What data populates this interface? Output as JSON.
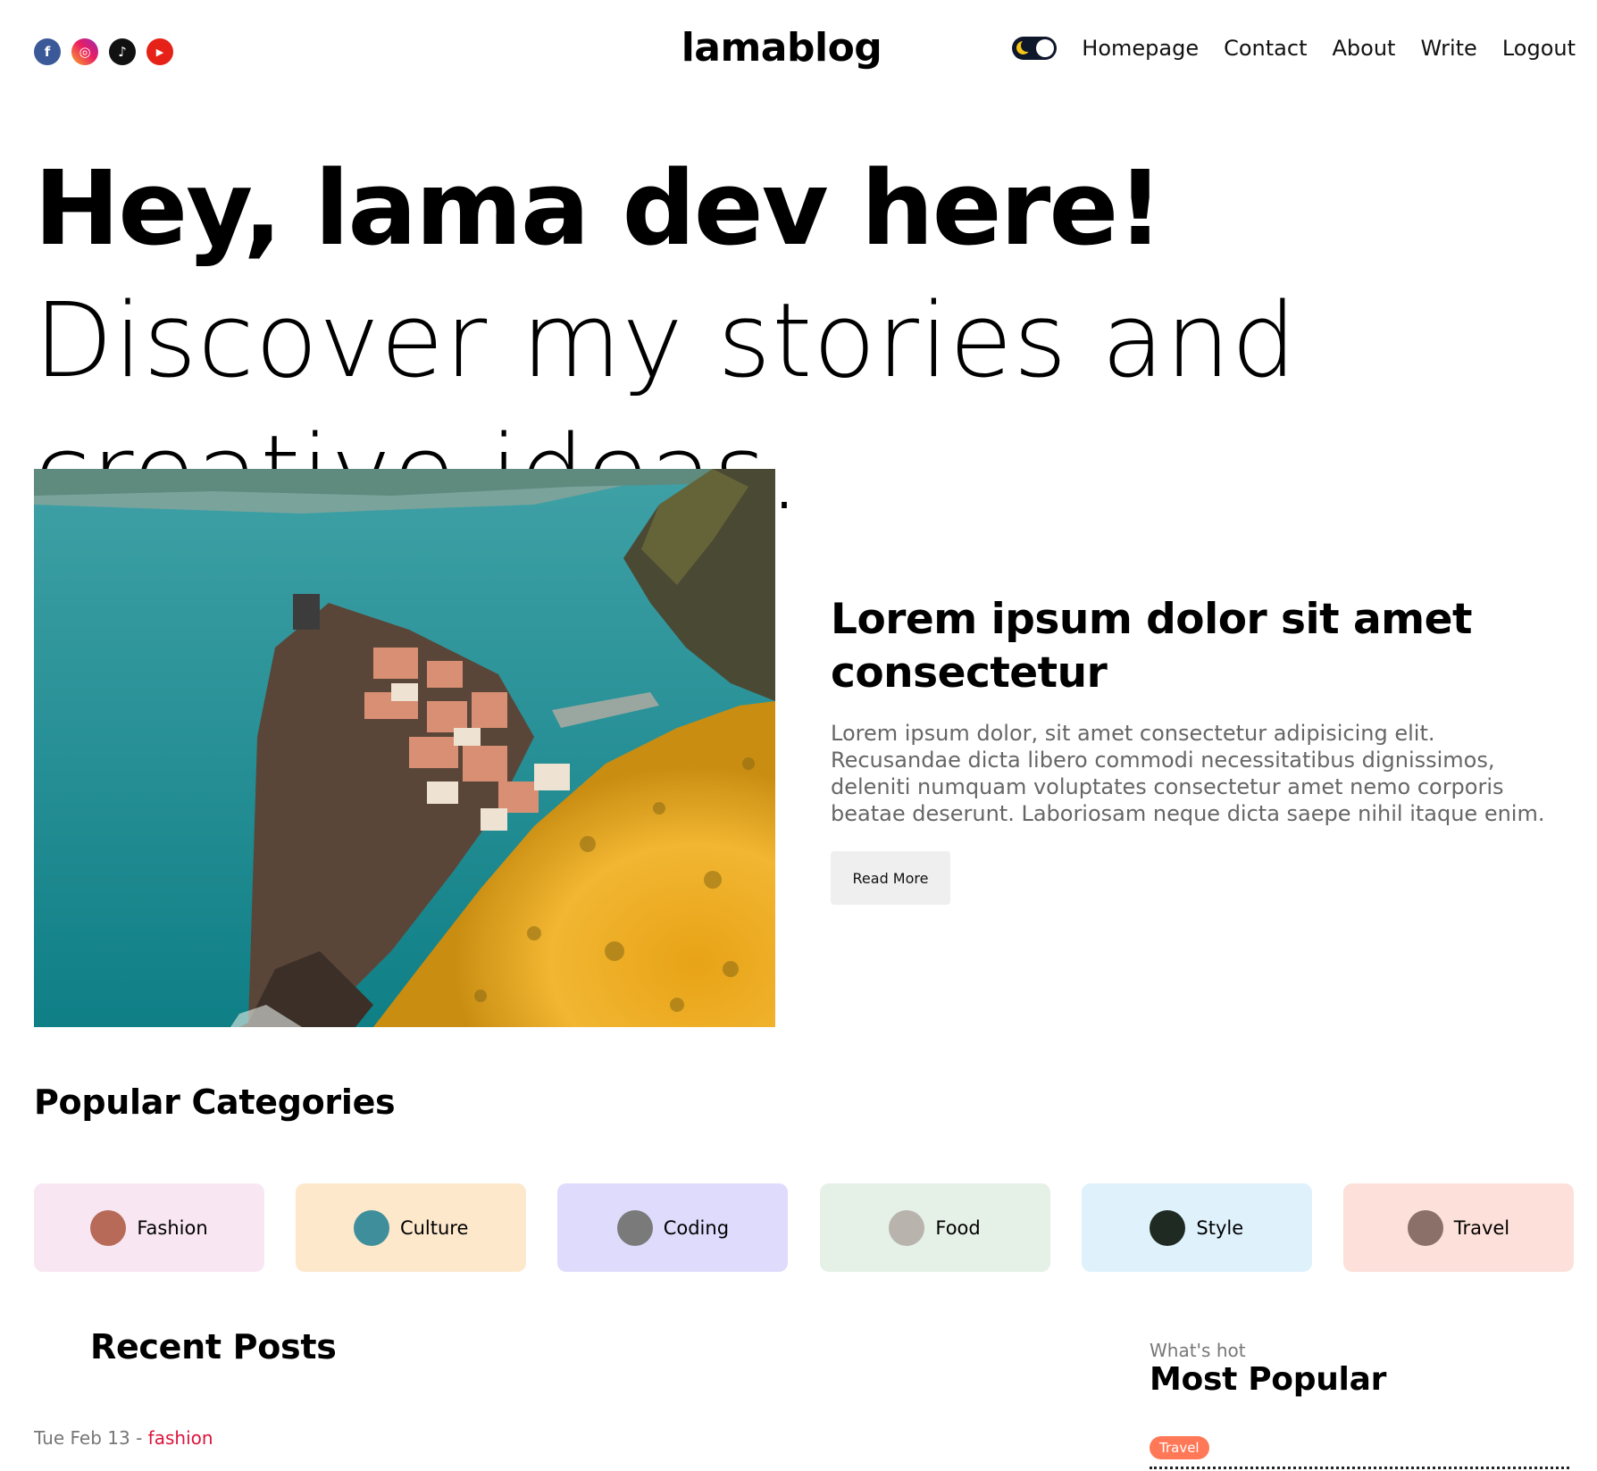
{
  "navbar": {
    "socials": [
      {
        "icon": "facebook-icon",
        "glyph": "f"
      },
      {
        "icon": "instagram-icon",
        "glyph": "◎"
      },
      {
        "icon": "tiktok-icon",
        "glyph": "♪"
      },
      {
        "icon": "youtube-icon",
        "glyph": "▶"
      }
    ],
    "logo": "lamablog",
    "links": [
      "Homepage",
      "Contact",
      "About",
      "Write",
      "Logout"
    ]
  },
  "hero": {
    "bold": "Hey, lama dev here!",
    "rest": " Discover my stories and creative ideas."
  },
  "featured": {
    "title": "Lorem ipsum dolor sit amet consectetur",
    "description": "Lorem ipsum dolor, sit amet consectetur adipisicing elit. Recusandae dicta libero commodi necessitatibus dignissimos, deleniti numquam voluptates consectetur amet nemo corporis beatae deserunt. Laboriosam neque dicta saepe nihil itaque enim.",
    "button": "Read More"
  },
  "categories": {
    "title": "Popular Categories",
    "items": [
      {
        "label": "Fashion",
        "bg": "#f8e7f2",
        "thumb": "#b86a58"
      },
      {
        "label": "Culture",
        "bg": "#fde8cc",
        "thumb": "#3e8f9b"
      },
      {
        "label": "Coding",
        "bg": "#dedbfc",
        "thumb": "#7a7a7a"
      },
      {
        "label": "Food",
        "bg": "#e5f0e6",
        "thumb": "#b9b3ad"
      },
      {
        "label": "Style",
        "bg": "#dff2fc",
        "thumb": "#1f2a22"
      },
      {
        "label": "Travel",
        "bg": "#fde0d9",
        "thumb": "#8a7068"
      }
    ]
  },
  "recent": {
    "title": "Recent Posts",
    "post": {
      "date": "Tue Feb 13",
      "separator": " - ",
      "category": "fashion"
    }
  },
  "popular": {
    "kicker": "What's hot",
    "title": "Most Popular",
    "tag": "Travel"
  }
}
